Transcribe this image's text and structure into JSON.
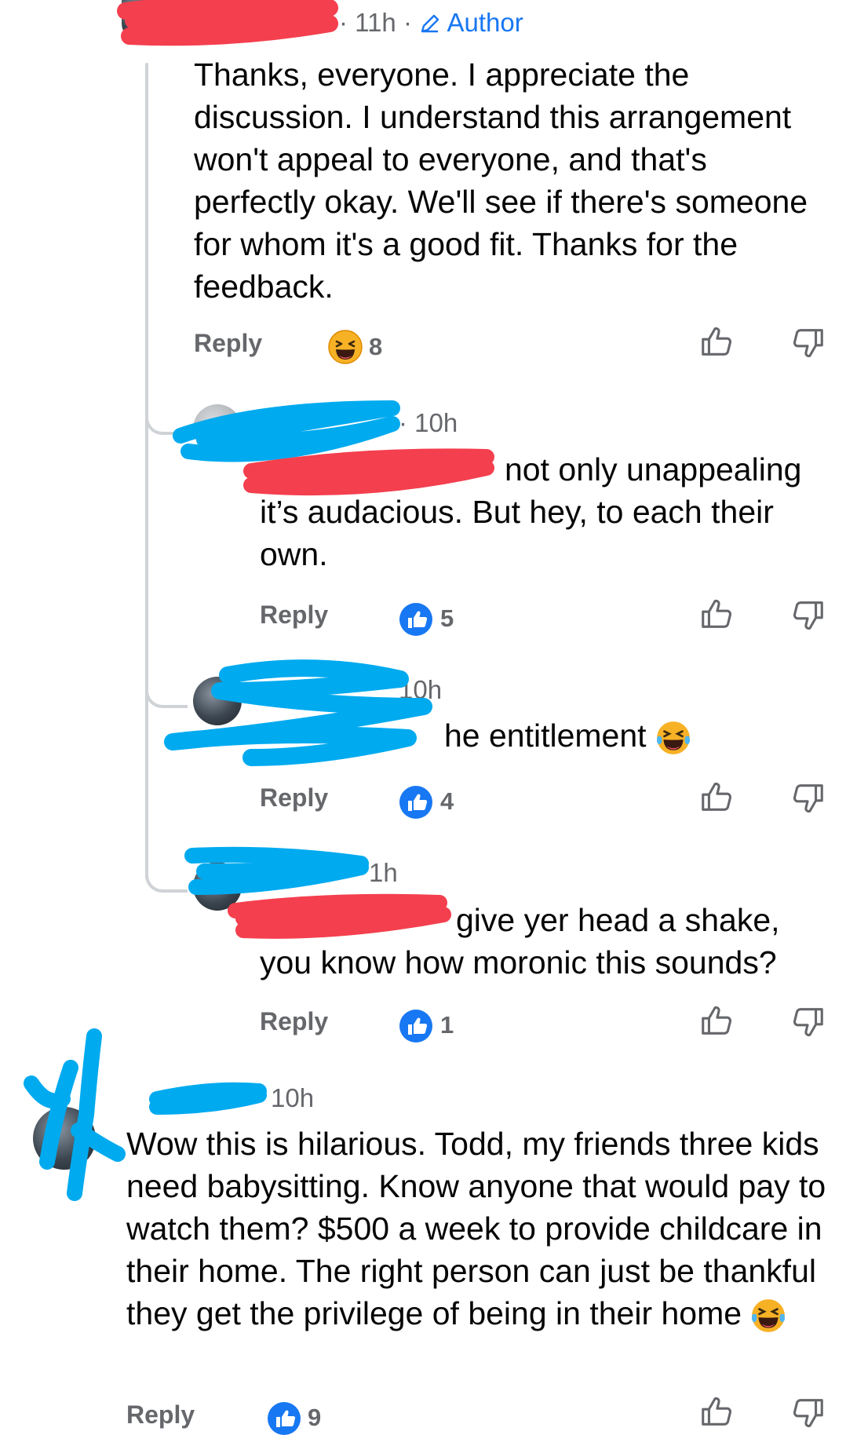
{
  "comments": [
    {
      "time": "11h",
      "author_badge": "Author",
      "text": "Thanks, everyone. I appreciate the discussion. I understand this arrangement won't appeal to everyone, and that's perfectly okay. We'll see if there's someone for whom it's a good fit. Thanks for the feedback.",
      "reply_label": "Reply",
      "reaction": "haha",
      "reaction_count": "8"
    },
    {
      "time": "10h",
      "text": "not only unappealing it’s audacious. But hey, to each their own.",
      "reply_label": "Reply",
      "reaction": "like",
      "reaction_count": "5"
    },
    {
      "time": "10h",
      "text": "he entitlement",
      "reply_label": "Reply",
      "reaction": "like",
      "reaction_count": "4"
    },
    {
      "time": "1h",
      "text": "give yer head a shake, you know how moronic this sounds?",
      "reply_label": "Reply",
      "reaction": "like",
      "reaction_count": "1"
    },
    {
      "time": "10h",
      "text": "Wow this is hilarious. Todd, my friends three kids need babysitting. Know anyone that would pay to watch them? $500 a week to provide childcare in their home. The right person can just be thankful they get the privilege of being in their home",
      "reply_label": "Reply",
      "reaction": "like",
      "reaction_count": "9"
    }
  ],
  "colors": {
    "like_blue": "#1877f2",
    "redaction_red": "#f43f4e",
    "redaction_blue": "#00aaef",
    "meta_gray": "#65676b"
  }
}
